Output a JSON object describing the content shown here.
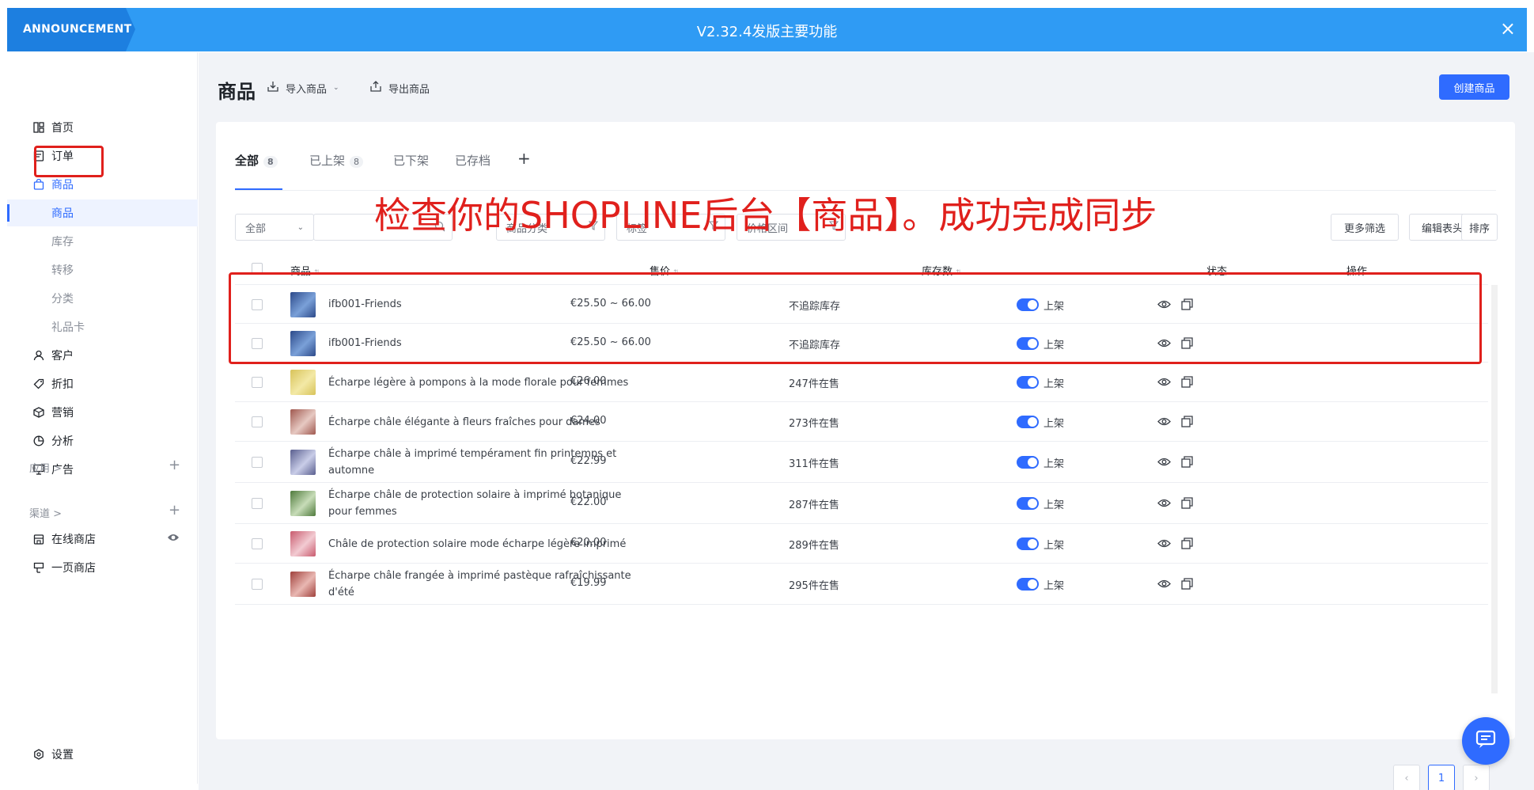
{
  "announcement": {
    "tag": "ANNOUNCEMENT",
    "title": "V2.32.4发版主要功能",
    "close": "×"
  },
  "sidebar": {
    "items": [
      {
        "label": "首页",
        "icon": "dashboard-icon"
      },
      {
        "label": "订单",
        "icon": "order-icon"
      },
      {
        "label": "商品",
        "icon": "bag-icon"
      },
      {
        "label": "商品"
      },
      {
        "label": "库存"
      },
      {
        "label": "转移"
      },
      {
        "label": "分类"
      },
      {
        "label": "礼品卡"
      },
      {
        "label": "客户",
        "icon": "user-icon"
      },
      {
        "label": "折扣",
        "icon": "tag-icon"
      },
      {
        "label": "营销",
        "icon": "marketing-icon"
      },
      {
        "label": "分析",
        "icon": "pie-icon"
      },
      {
        "label": "广告",
        "icon": "ad-icon"
      }
    ],
    "apps_label": "应用 >",
    "channels_label": "渠道 >",
    "channels": [
      {
        "label": "在线商店"
      },
      {
        "label": "一页商店"
      }
    ],
    "settings_label": "设置"
  },
  "header": {
    "title": "商品",
    "import_label": "导入商品",
    "export_label": "导出商品",
    "create_label": "创建商品"
  },
  "tabs": [
    {
      "label": "全部",
      "count": "8"
    },
    {
      "label": "已上架",
      "count": "8"
    },
    {
      "label": "已下架"
    },
    {
      "label": "已存档"
    },
    {
      "label": "+"
    }
  ],
  "filters": {
    "scope": "全部",
    "category": "商品分类",
    "tag": "标签",
    "price": "价格区间",
    "more": "更多筛选",
    "edit_header": "编辑表头",
    "sort": "排序"
  },
  "overlay_text": "检查你的SHOPLINE后台【商品】。成功完成同步",
  "table": {
    "columns": [
      "商品",
      "售价",
      "库存数",
      "状态",
      "操作"
    ],
    "rows": [
      {
        "name": "ifb001-Friends",
        "price": "€25.50 ~ 66.00",
        "stock": "不追踪库存",
        "status": "上架"
      },
      {
        "name": "ifb001-Friends",
        "price": "€25.50 ~ 66.00",
        "stock": "不追踪库存",
        "status": "上架"
      },
      {
        "name": "Écharpe légère à pompons à la mode florale pour femmes",
        "price": "€26.00",
        "stock": "247件在售",
        "status": "上架"
      },
      {
        "name": "Écharpe châle élégante à fleurs fraîches pour dames",
        "price": "€24.00",
        "stock": "273件在售",
        "status": "上架"
      },
      {
        "name": "Écharpe châle à imprimé tempérament fin printemps et automne",
        "price": "€22.99",
        "stock": "311件在售",
        "status": "上架"
      },
      {
        "name": "Écharpe châle de protection solaire à imprimé botanique pour femmes",
        "price": "€22.00",
        "stock": "287件在售",
        "status": "上架"
      },
      {
        "name": "Châle de protection solaire mode écharpe légère imprimé",
        "price": "€20.00",
        "stock": "289件在售",
        "status": "上架"
      },
      {
        "name": "Écharpe châle frangée à imprimé pastèque rafraîchissante d'été",
        "price": "€19.99",
        "stock": "295件在售",
        "status": "上架"
      }
    ]
  },
  "pagination": {
    "prev": "‹",
    "current": "1",
    "next": "›"
  },
  "colors": {
    "accent": "#2f6bff",
    "announce_bg": "#2f9bf4",
    "highlight": "#e0201c"
  }
}
